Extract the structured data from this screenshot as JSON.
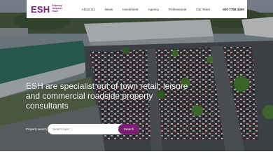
{
  "brand": {
    "mark": "ESH",
    "name_line1": "Edgerley",
    "name_line2": "Simpson",
    "name_line3": "Howe",
    "color": "#7a1f74"
  },
  "nav": {
    "items": [
      {
        "label": "About Us"
      },
      {
        "label": "News"
      },
      {
        "label": "Investment"
      },
      {
        "label": "Agency"
      },
      {
        "label": "Professional"
      },
      {
        "label": "Our Team"
      }
    ],
    "phone": "020 7758 3400"
  },
  "hero": {
    "headline": "ESH are specialist out of town retail, leisure and commercial roadside property consultants",
    "image": "aerial-retail-park-car-park"
  },
  "search": {
    "label": "Property search",
    "placeholder": "Search here ...",
    "button_label": "Search",
    "button_color": "#7a1f74"
  }
}
